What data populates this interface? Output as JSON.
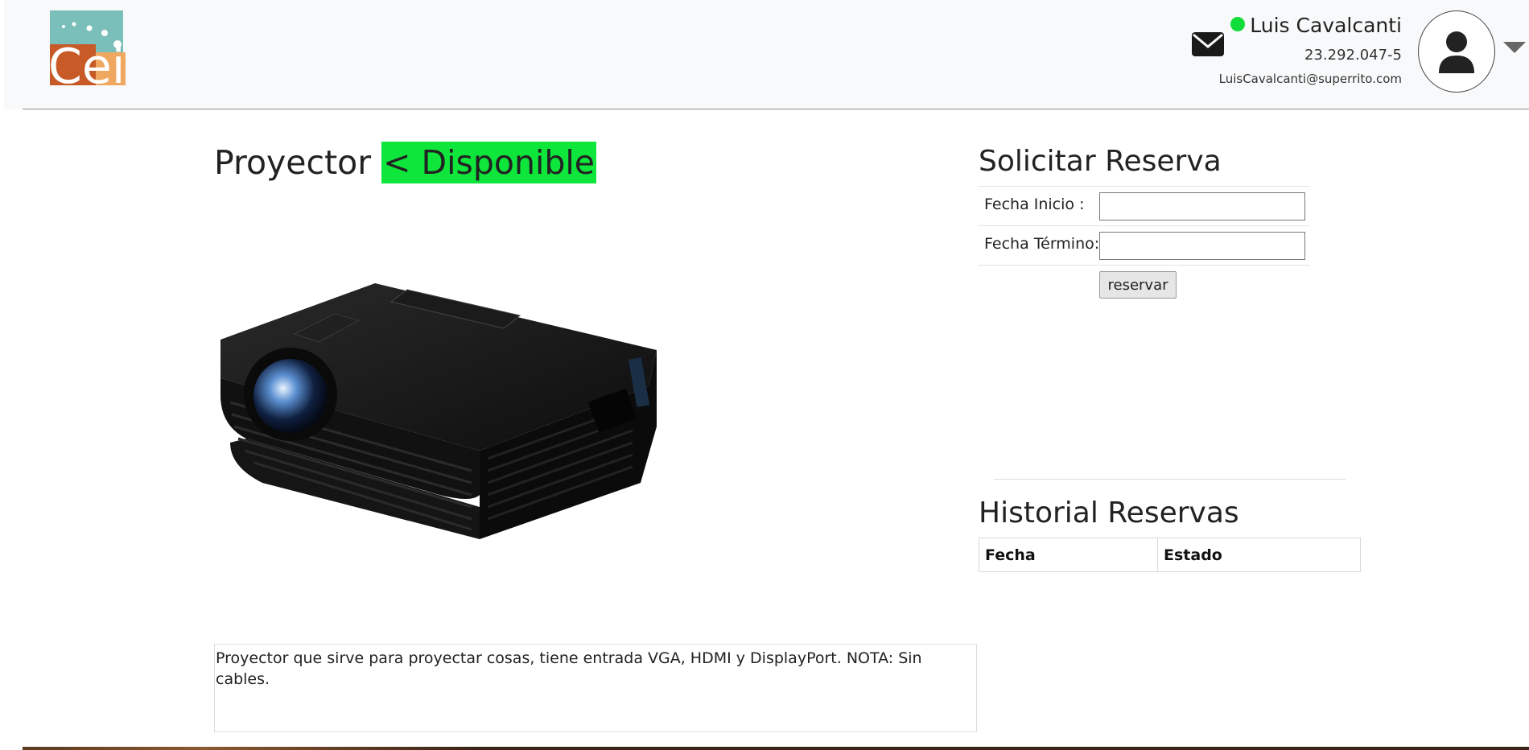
{
  "header": {
    "logo_text": "Cei",
    "user": {
      "name": "Luis Cavalcanti",
      "status": "online",
      "rut": "23.292.047-5",
      "email": "LuisCavalcanti@superrito.com"
    },
    "icons": {
      "mail": "envelope-icon",
      "avatar": "user-icon",
      "menu": "caret-down-icon"
    }
  },
  "product": {
    "name": "Proyector",
    "status_label": "< Disponible",
    "status_color": "#0fe63b",
    "image": "projector-image",
    "description": "Proyector que sirve para proyectar cosas, tiene entrada VGA, HDMI y DisplayPort. NOTA: Sin cables."
  },
  "reservation": {
    "title": "Solicitar Reserva",
    "start_label": "Fecha Inicio :",
    "start_value": "",
    "end_label": "Fecha Término:",
    "end_value": "",
    "submit_label": "reservar"
  },
  "history": {
    "title": "Historial Reservas",
    "columns": [
      "Fecha",
      "Estado"
    ],
    "rows": []
  }
}
